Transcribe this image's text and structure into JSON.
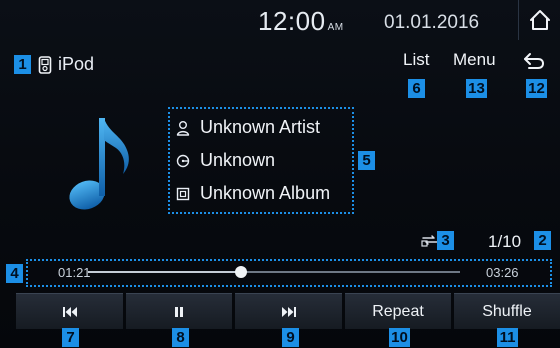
{
  "status_bar": {
    "time": "12:00",
    "ampm": "AM",
    "date": "01.01.2016"
  },
  "header": {
    "source": "iPod",
    "list_label": "List",
    "menu_label": "Menu"
  },
  "track": {
    "artist": "Unknown Artist",
    "title": "Unknown",
    "album": "Unknown Album",
    "track_number": "1/10"
  },
  "progress": {
    "elapsed": "01:21",
    "total": "03:26",
    "fraction": 0.41
  },
  "controls": {
    "repeat_label": "Repeat",
    "shuffle_label": "Shuffle"
  },
  "callouts": [
    "1",
    "2",
    "3",
    "4",
    "5",
    "6",
    "7",
    "8",
    "9",
    "10",
    "11",
    "12",
    "13"
  ],
  "icons": {
    "home": "home-icon",
    "back": "back-arrow-icon",
    "device": "ipod-icon",
    "artist": "person-icon",
    "song": "disc-icon",
    "album": "album-icon",
    "note": "music-note-icon",
    "repeat_mode": "repeat-mode-icon",
    "previous": "previous-track-icon",
    "pause": "pause-icon",
    "next": "next-track-icon"
  },
  "colors": {
    "accent": "#1c8fe6",
    "note_gradient_top": "#4fb6f2",
    "note_gradient_bottom": "#0f5fa8"
  }
}
